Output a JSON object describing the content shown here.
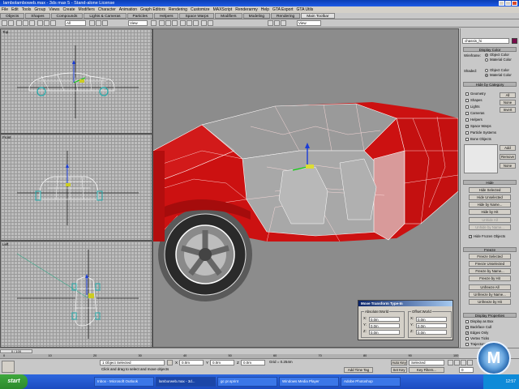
{
  "window": {
    "title": "lambolamboweb.max - 3ds max 5 - Stand-alone License"
  },
  "menu": [
    "File",
    "Edit",
    "Tools",
    "Group",
    "Views",
    "Create",
    "Modifiers",
    "Character",
    "Animation",
    "Graph Editors",
    "Rendering",
    "Customize",
    "MAXScript",
    "Renderarmy",
    "Help",
    "GTA Export",
    "GTA Utils"
  ],
  "tabs": [
    "Objects",
    "Shapes",
    "Compounds",
    "Lights & Cameras",
    "Particles",
    "Helpers",
    "Space Warps",
    "Modifiers",
    "Modeling",
    "Rendering",
    "Main Toolbar"
  ],
  "active_tab_index": 10,
  "toolbar": {
    "selection_filter": "All",
    "ref_coord": "View",
    "named_selection": "View"
  },
  "command_panel": {
    "object_name": "chassis_hi",
    "color_swatch": "#7a0a4a",
    "display_color": {
      "title": "Display Color",
      "wireframe_label": "Wireframe:",
      "shaded_label": "Shaded:",
      "object_color": "Object Color",
      "material_color": "Material Color"
    },
    "hide_by_category": {
      "title": "Hide by Category",
      "items": [
        {
          "label": "Geometry",
          "checked": false
        },
        {
          "label": "Shapes",
          "checked": false
        },
        {
          "label": "Lights",
          "checked": false
        },
        {
          "label": "Cameras",
          "checked": false
        },
        {
          "label": "Helpers",
          "checked": false
        },
        {
          "label": "Space Warps",
          "checked": true
        },
        {
          "label": "Particle Systems",
          "checked": false
        },
        {
          "label": "Bone Objects",
          "checked": false
        }
      ],
      "all": "All",
      "none": "None",
      "invert": "Invert",
      "add": "Add",
      "remove": "Remove",
      "none2": "None"
    },
    "hide": {
      "title": "Hide",
      "buttons": [
        "Hide Selected",
        "Hide Unselected",
        "Hide by Name...",
        "Hide by Hit",
        "Unhide All",
        "Unhide by Name...",
        "Hide Frozen Objects"
      ]
    },
    "freeze": {
      "title": "Freeze",
      "buttons": [
        "Freeze Selected",
        "Freeze Unselected",
        "Freeze by Name...",
        "Freeze by Hit",
        "Unfreeze All",
        "Unfreeze by Name...",
        "Unfreeze by Hit"
      ]
    },
    "display_properties": {
      "title": "Display Properties",
      "items": [
        {
          "label": "Display as Box",
          "checked": false
        },
        {
          "label": "Backface Cull",
          "checked": true
        },
        {
          "label": "Edges Only",
          "checked": true
        },
        {
          "label": "Vertex Ticks",
          "checked": false
        },
        {
          "label": "Trajectory",
          "checked": false
        },
        {
          "label": "See-Through",
          "checked": false
        }
      ]
    }
  },
  "typein": {
    "title": "Move Transform Type-In",
    "absolute_label": "Absolute:World",
    "offset_label": "Offset:World",
    "axes": [
      "X:",
      "Y:",
      "Z:"
    ],
    "absolute_values": [
      "0.0m",
      "0.0m",
      "0.0m"
    ],
    "offset_values": [
      "0.0m",
      "0.0m",
      "0.0m"
    ]
  },
  "timeline": {
    "frame_label": "0 / 100",
    "ticks": [
      "0",
      "10",
      "20",
      "30",
      "40",
      "50",
      "60",
      "70",
      "80",
      "90",
      "100"
    ]
  },
  "status": {
    "selection": "1 Object Selected",
    "prompt": "Click and drag to select and move objects",
    "x": "0.0m",
    "y": "0.0m",
    "z": "0.0m",
    "grid": "Grid = 0.254m",
    "add_time_tag": "Add Time Tag",
    "auto_key": "Auto Key",
    "set_key": "Set Key",
    "key_filters": "Key Filters...",
    "selected": "Selected",
    "frame": "0"
  },
  "taskbar": {
    "start": "start",
    "tasks": [
      "Inbox - Microsoft Outlook",
      "lamborweb.max - 3d...",
      "gc pr.sprint",
      "Windows Media Player",
      "Adobe Photoshop"
    ],
    "active_index": 1,
    "clock": "12:57"
  },
  "colors": {
    "car_body": "#cc1111",
    "wire": "#ffffff",
    "title_bar": "#0a3db4",
    "taskbar": "#2d67de"
  }
}
